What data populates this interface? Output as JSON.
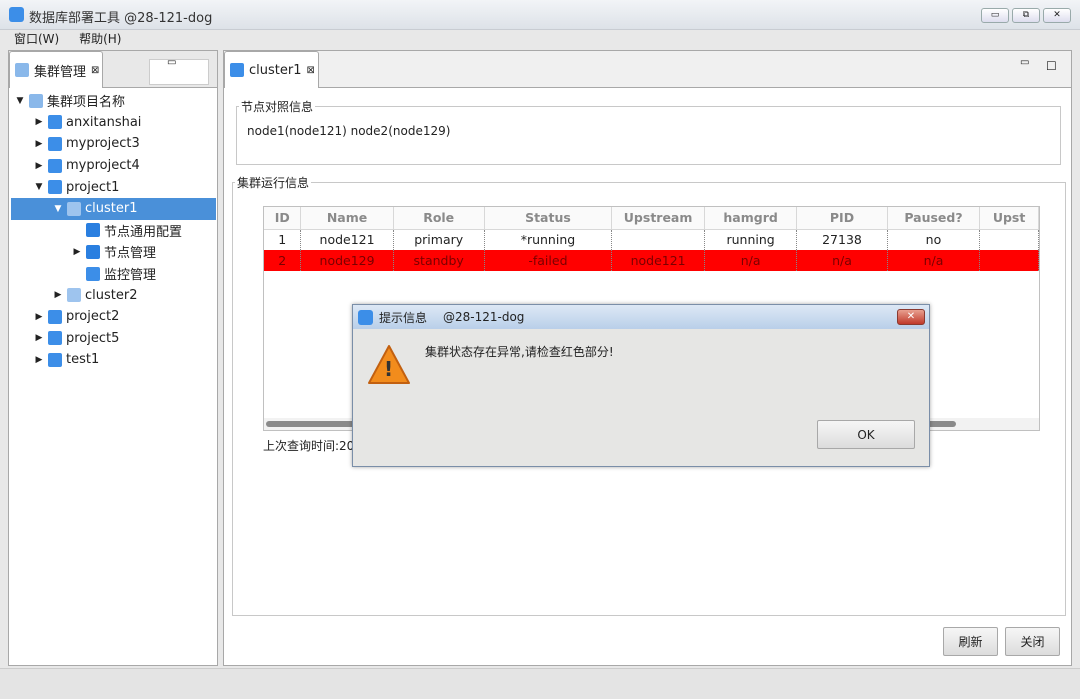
{
  "window": {
    "title": "数据库部署工具 @28-121-dog",
    "min": "▭",
    "restore": "⧉",
    "close": "✕"
  },
  "menu": [
    "窗口(W)",
    "帮助(H)"
  ],
  "left_panel": {
    "tab": "集群管理",
    "tab_close": "⊠",
    "minimize": "▭",
    "tree": [
      {
        "label": "集群项目名称",
        "level": 0,
        "arrow": "▼",
        "icon": "cluster-root-icon"
      },
      {
        "label": "anxitanshai",
        "level": 1,
        "arrow": "▶",
        "icon": "project-icon"
      },
      {
        "label": "myproject3",
        "level": 1,
        "arrow": "▶",
        "icon": "project-icon"
      },
      {
        "label": "myproject4",
        "level": 1,
        "arrow": "▶",
        "icon": "project-icon"
      },
      {
        "label": "project1",
        "level": 1,
        "arrow": "▼",
        "icon": "project-icon"
      },
      {
        "label": "cluster1",
        "level": 2,
        "arrow": "▼",
        "icon": "cluster-icon",
        "selected": true
      },
      {
        "label": "节点通用配置",
        "level": 3,
        "arrow": "",
        "icon": "database-icon"
      },
      {
        "label": "节点管理",
        "level": 3,
        "arrow": "▶",
        "icon": "database-icon"
      },
      {
        "label": "监控管理",
        "level": 3,
        "arrow": "",
        "icon": "monitor-icon"
      },
      {
        "label": "cluster2",
        "level": 2,
        "arrow": "▶",
        "icon": "cluster-icon"
      },
      {
        "label": "project2",
        "level": 1,
        "arrow": "▶",
        "icon": "project-icon"
      },
      {
        "label": "project5",
        "level": 1,
        "arrow": "▶",
        "icon": "project-icon"
      },
      {
        "label": "test1",
        "level": 1,
        "arrow": "▶",
        "icon": "project-icon"
      }
    ]
  },
  "editor": {
    "tab": "cluster1",
    "tab_close": "⊠",
    "minimize": "▭",
    "maximize": "☐",
    "node_map": {
      "legend": "节点对照信息",
      "text": "node1(node121)  node2(node129)"
    },
    "run_info": {
      "legend": "集群运行信息",
      "columns": [
        "ID",
        "Name",
        "Role",
        "Status",
        "Upstream",
        "hamgrd",
        "PID",
        "Paused?",
        "Upst"
      ],
      "rows": [
        [
          "1",
          "node121",
          "primary",
          "*running",
          "",
          "running",
          "27138",
          "no",
          ""
        ],
        [
          "2",
          "node129",
          "standby",
          "-failed",
          "node121",
          "n/a",
          "n/a",
          "n/a",
          ""
        ]
      ],
      "last_query": "上次查询时间:20"
    },
    "refresh": "刷新",
    "close": "关闭"
  },
  "dialog": {
    "title": "提示信息",
    "host": "@28-121-dog",
    "close": "✕",
    "message": "集群状态存在异常,请检查红色部分!",
    "ok": "OK",
    "warning": "!"
  }
}
